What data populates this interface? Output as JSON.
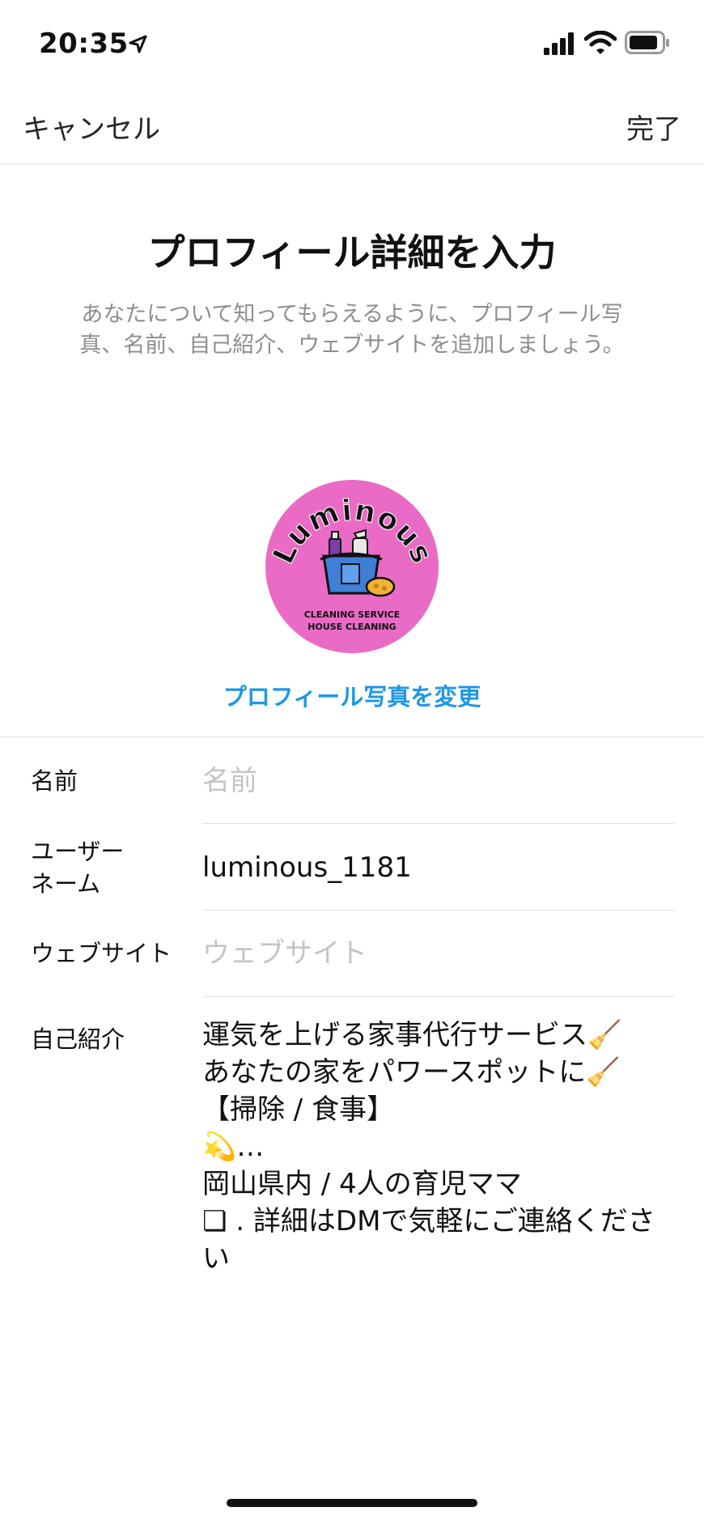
{
  "status_bar": {
    "time": "20:35"
  },
  "nav": {
    "cancel_label": "キャンセル",
    "done_label": "完了"
  },
  "header": {
    "title": "プロフィール詳細を入力",
    "subtitle": "あなたについて知ってもらえるように、プロフィール写真、名前、自己紹介、ウェブサイトを追加しましょう。"
  },
  "avatar": {
    "brand_text": "Luminous",
    "line1": "CLEANING SERVICE",
    "line2": "HOUSE CLEANING",
    "background_color": "#ea6bc6"
  },
  "change_photo_label": "プロフィール写真を変更",
  "fields": {
    "name": {
      "label": "名前",
      "value": "",
      "placeholder": "名前"
    },
    "username": {
      "label": "ユーザーネーム",
      "value": "luminous_1181"
    },
    "website": {
      "label": "ウェブサイト",
      "value": "",
      "placeholder": "ウェブサイト"
    },
    "bio": {
      "label": "自己紹介",
      "lines": [
        "運気を上げる家事代行サービス🧹",
        "あなたの家をパワースポットに🧹",
        "【掃除 / 食事】",
        "💫…",
        "岡山県内 / 4人の育児ママ",
        "❏ . 詳細はDMで気軽にご連絡ください"
      ]
    }
  },
  "colors": {
    "accent": "#1e97e8",
    "placeholder": "#c4c4c4",
    "subtitle": "#8e8e8e",
    "divider": "#e3e3e3"
  }
}
